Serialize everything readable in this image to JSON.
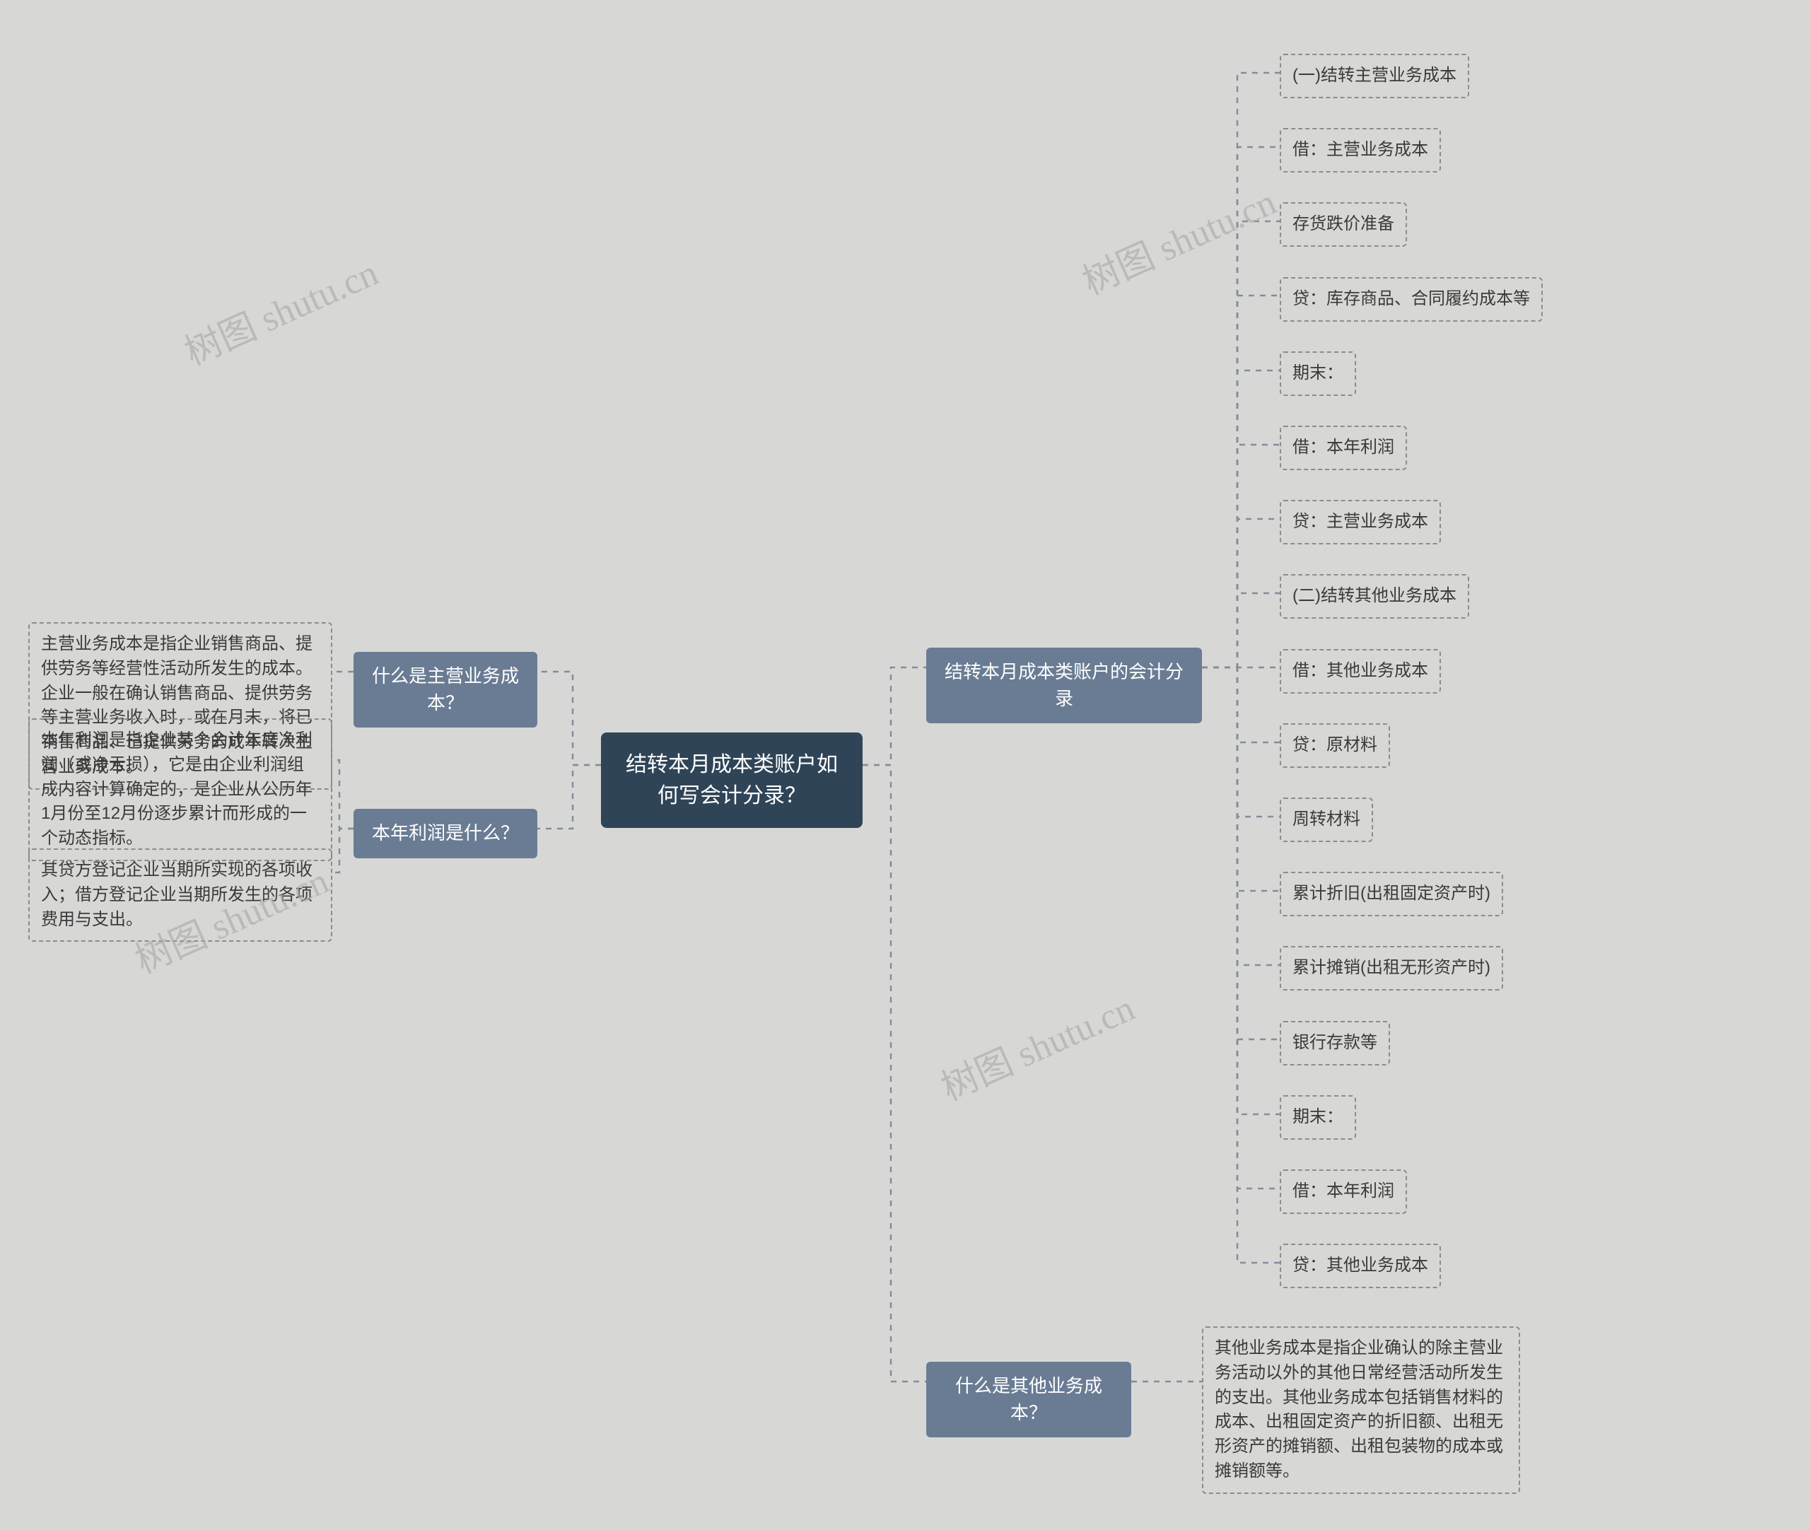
{
  "root": {
    "title": "结转本月成本类账户如何写会计分录？"
  },
  "branches": {
    "rightTop": {
      "label": "结转本月成本类账户的会计分录"
    },
    "rightBottom": {
      "label": "什么是其他业务成本？"
    },
    "leftTop": {
      "label": "什么是主营业务成本？"
    },
    "leftBottom": {
      "label": "本年利润是什么？"
    }
  },
  "rightTopChildren": [
    "(一)结转主营业务成本",
    "借：主营业务成本",
    "存货跌价准备",
    "贷：库存商品、合同履约成本等",
    "期末：",
    "借：本年利润",
    "贷：主营业务成本",
    "(二)结转其他业务成本",
    "借：其他业务成本",
    "贷：原材料",
    "周转材料",
    "累计折旧(出租固定资产时)",
    "累计摊销(出租无形资产时)",
    "银行存款等",
    "期末：",
    "借：本年利润",
    "贷：其他业务成本"
  ],
  "rightBottom": {
    "desc": "其他业务成本是指企业确认的除主营业务活动以外的其他日常经营活动所发生的支出。其他业务成本包括销售材料的成本、出租固定资产的折旧额、出租无形资产的摊销额、出租包装物的成本或摊销额等。"
  },
  "leftTop": {
    "desc": "主营业务成本是指企业销售商品、提供劳务等经营性活动所发生的成本。企业一般在确认销售商品、提供劳务等主营业务收入时，或在月末，将已销售商品、已提供劳务的成本转入主营业务成本。"
  },
  "leftBottom": {
    "desc1": "本年利润是指企业某个会计年度净利润（或净亏损），它是由企业利润组成内容计算确定的，是企业从公历年1月份至12月份逐步累计而形成的一个动态指标。",
    "desc2": "其贷方登记企业当期所实现的各项收入；借方登记企业当期所发生的各项费用与支出。"
  },
  "watermark": {
    "cn": "树图",
    "en": "shutu.cn"
  }
}
